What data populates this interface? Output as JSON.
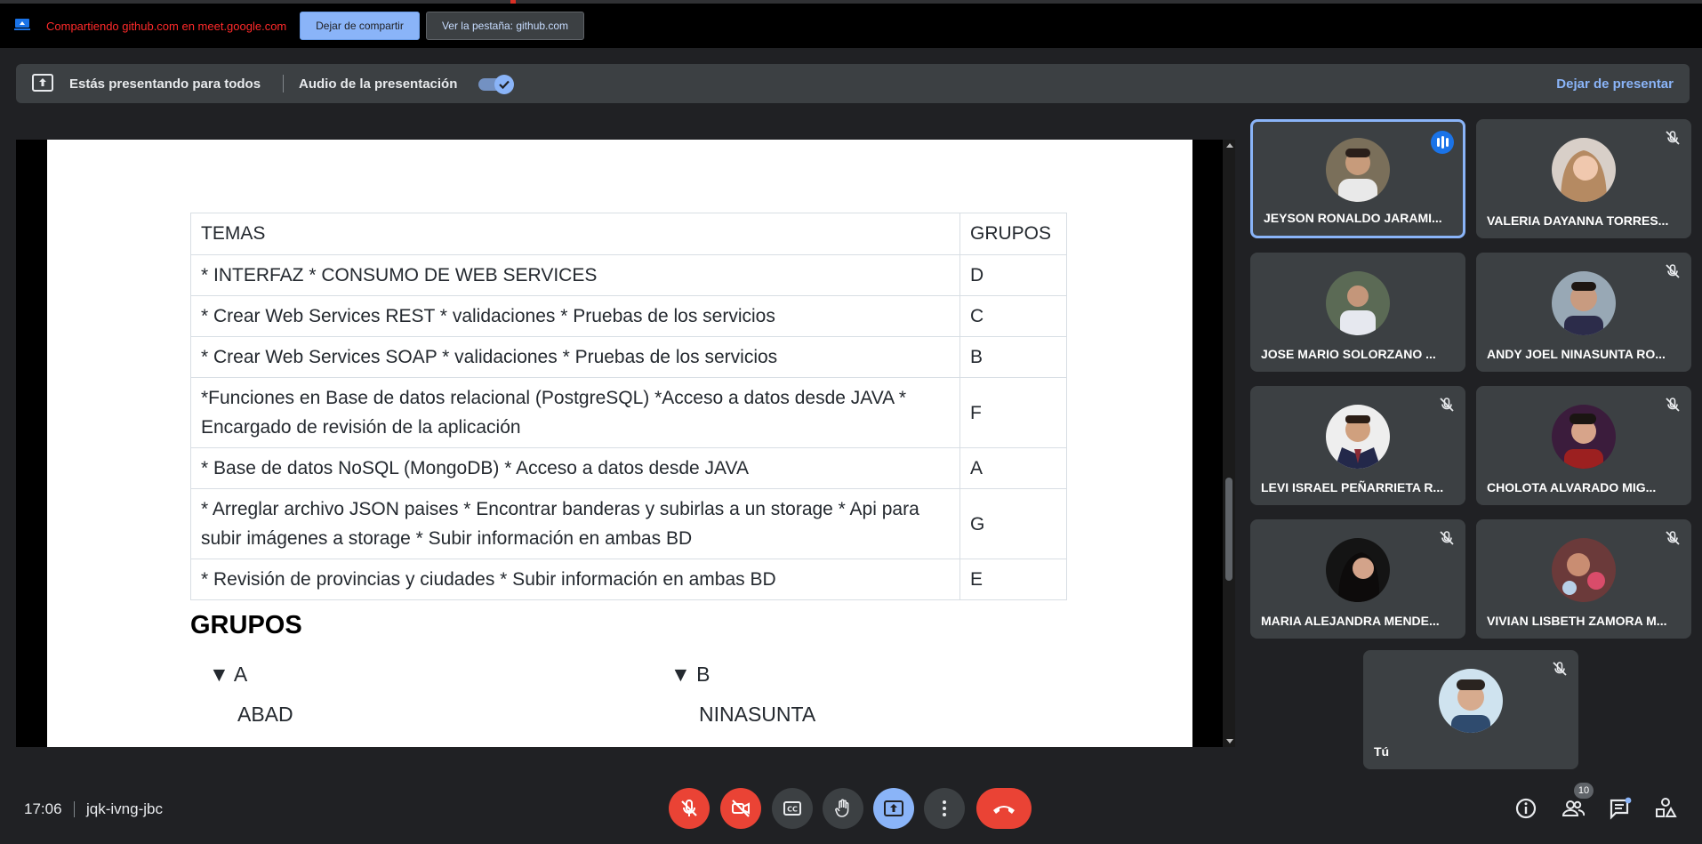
{
  "share_banner": {
    "text": "Compartiendo github.com en meet.google.com",
    "stop_sharing_label": "Dejar de compartir",
    "view_tab_label": "Ver la pestaña: github.com"
  },
  "present_bar": {
    "presenting_text": "Estás presentando para todos",
    "audio_label": "Audio de la presentación",
    "audio_enabled": true,
    "stop_presenting_label": "Dejar de presentar"
  },
  "document": {
    "table": {
      "headers": [
        "TEMAS",
        "GRUPOS"
      ],
      "rows": [
        [
          "* INTERFAZ * CONSUMO DE WEB SERVICES",
          "D"
        ],
        [
          "* Crear Web Services REST * validaciones * Pruebas de los servicios",
          "C"
        ],
        [
          "* Crear Web Services SOAP * validaciones * Pruebas de los servicios",
          "B"
        ],
        [
          "*Funciones en Base de datos relacional (PostgreSQL) *Acceso a datos desde JAVA * Encargado de revisión de la aplicación",
          "F"
        ],
        [
          "* Base de datos NoSQL (MongoDB) * Acceso a datos desde JAVA",
          "A"
        ],
        [
          "* Arreglar archivo JSON paises * Encontrar banderas y subirlas a un storage * Api para subir imágenes a storage * Subir información en ambas BD",
          "G"
        ],
        [
          "* Revisión de provincias y ciudades * Subir información en ambas BD",
          "E"
        ]
      ]
    },
    "groups_heading": "GRUPOS",
    "groups": [
      {
        "title": "▼ A",
        "first_member": "ABAD"
      },
      {
        "title": "▼ B",
        "first_member": "NINASUNTA"
      }
    ]
  },
  "participants": [
    {
      "name": "JEYSON RONALDO JARAMI...",
      "speaking": true
    },
    {
      "name": "VALERIA DAYANNA TORRES...",
      "muted": true
    },
    {
      "name": "JOSE MARIO SOLORZANO ...",
      "muted": false
    },
    {
      "name": "ANDY JOEL NINASUNTA RO...",
      "muted": true
    },
    {
      "name": "LEVI ISRAEL PEÑARRIETA R...",
      "muted": true
    },
    {
      "name": "CHOLOTA ALVARADO MIG...",
      "muted": true
    },
    {
      "name": "MARIA ALEJANDRA MENDE...",
      "muted": true
    },
    {
      "name": "VIVIAN LISBETH ZAMORA M...",
      "muted": true
    },
    {
      "name": "Tú",
      "muted": true
    }
  ],
  "bottom_bar": {
    "time": "17:06",
    "meeting_code": "jqk-ivng-jbc",
    "people_count": "10",
    "controls": [
      "mic-off-icon",
      "camera-off-icon",
      "captions-icon",
      "raise-hand-icon",
      "present-icon",
      "more-options-icon",
      "hang-up-icon"
    ]
  },
  "colors": {
    "background": "#202124",
    "tile": "#3c4043",
    "accent_blue": "#8ab4f8",
    "danger_red": "#ea4335",
    "share_text_red": "#ff2a2a"
  }
}
